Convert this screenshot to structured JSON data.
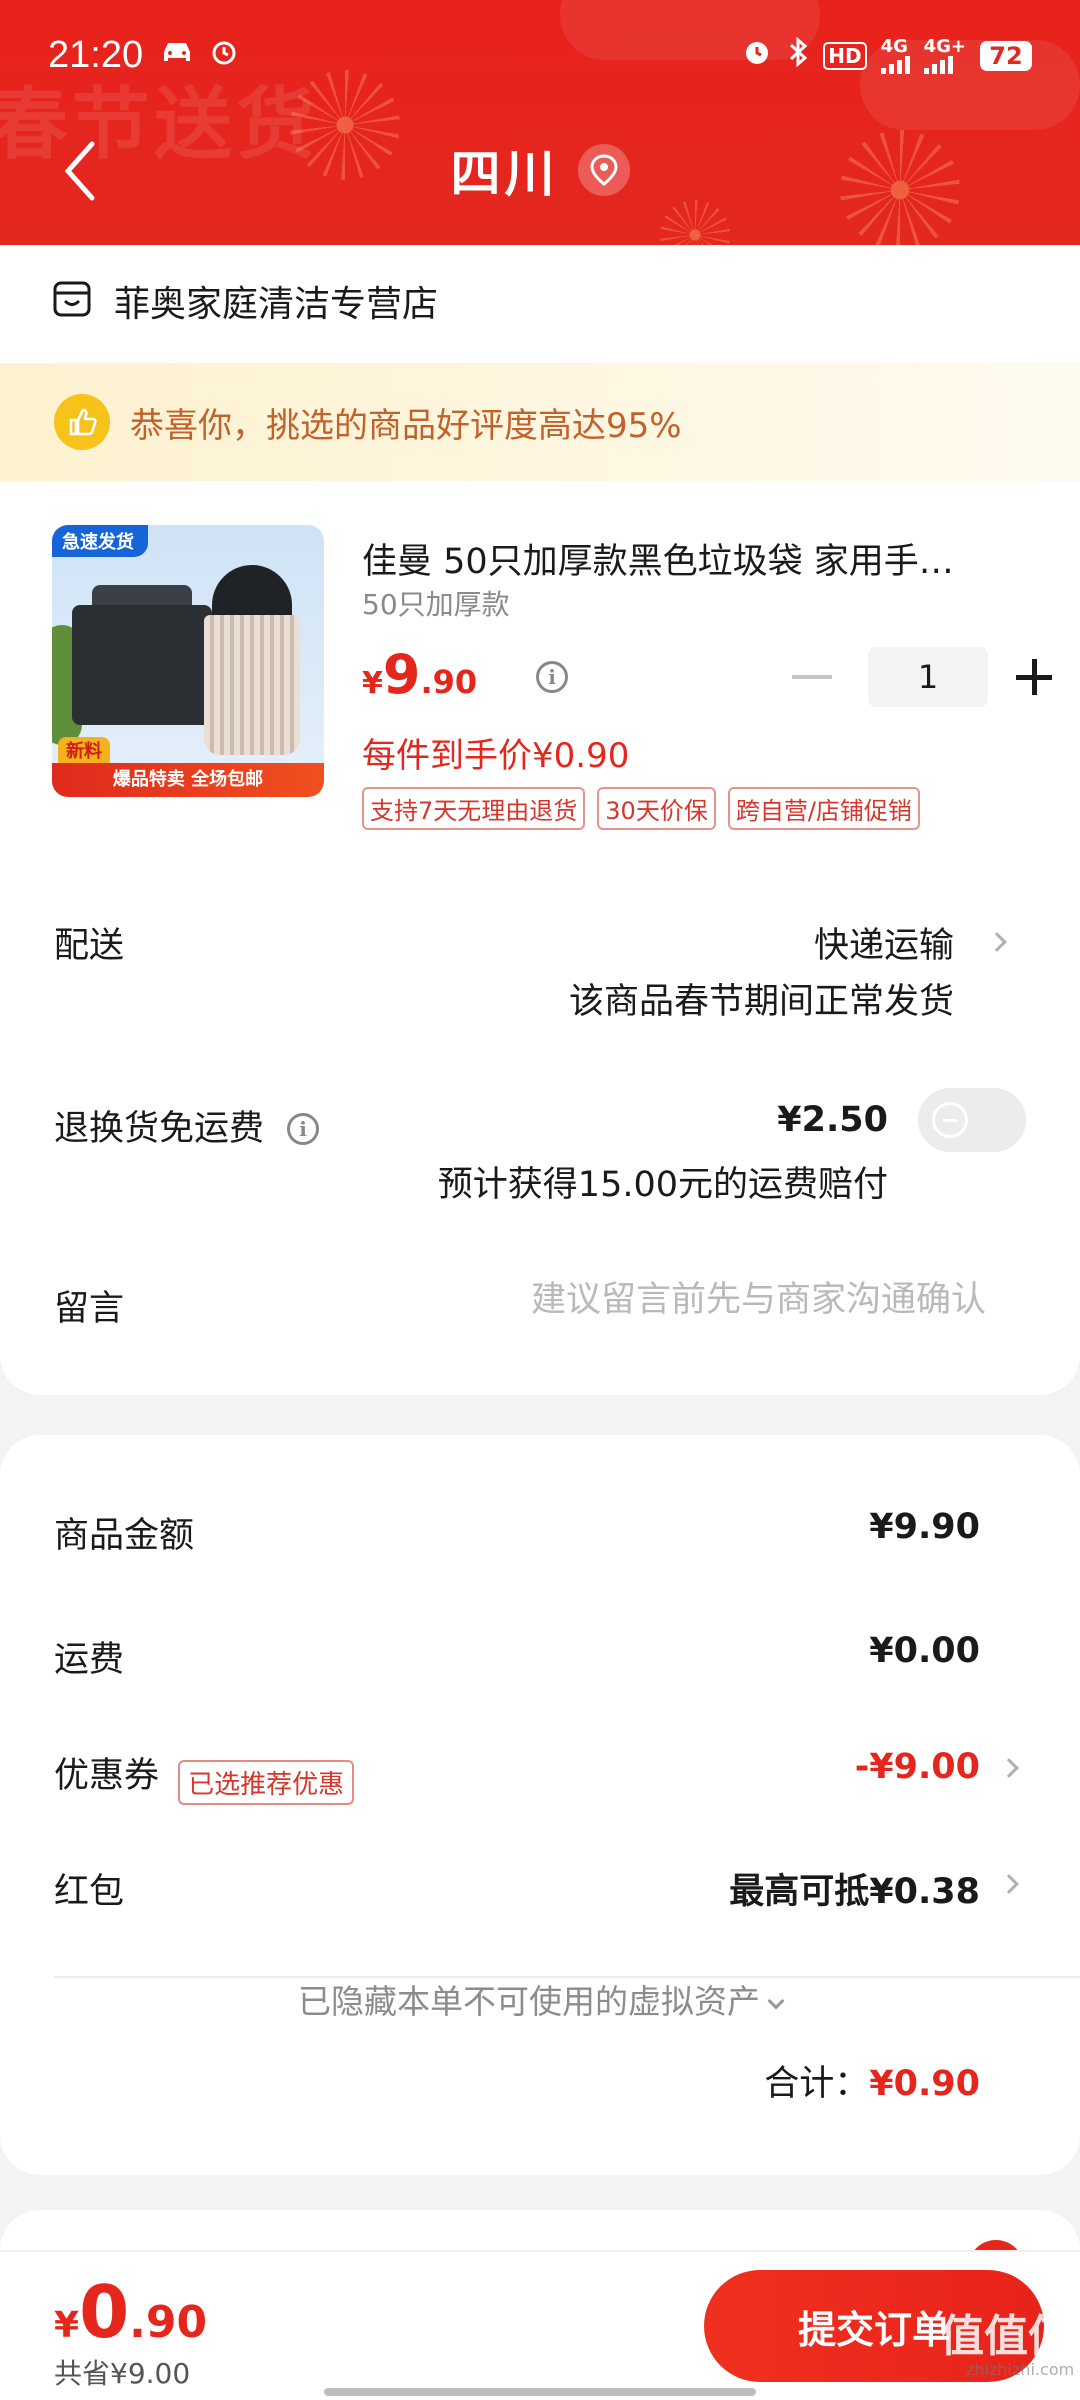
{
  "status_bar": {
    "time": "21:20",
    "battery": "72",
    "network_1": "4G",
    "network_2": "4G+",
    "hd_label": "HD"
  },
  "header": {
    "decor_text": "春节送货",
    "title": "四川"
  },
  "store": {
    "name": "菲奥家庭清洁专营店"
  },
  "banner": {
    "text": "恭喜你，挑选的商品好评度高达95%"
  },
  "product": {
    "title": "佳曼 50只加厚款黑色垃圾袋 家用手…",
    "spec": "50只加厚款",
    "price_currency": "¥",
    "price_int": "9",
    "price_dec": ".90",
    "quantity": "1",
    "unit_price": "每件到手价¥0.90",
    "image_tag_top": "急速发货",
    "image_tag_new": "新料",
    "image_tag_bottom": "爆品特卖 全场包邮",
    "chips": [
      "支持7天无理由退货",
      "30天价保",
      "跨自营/店铺促销"
    ]
  },
  "delivery": {
    "label": "配送",
    "method": "快递运输",
    "note": "该商品春节期间正常发货"
  },
  "return_shipping": {
    "label": "退换货免运费",
    "price": "¥2.50",
    "note": "预计获得15.00元的运费赔付",
    "enabled": false
  },
  "message": {
    "label": "留言",
    "value": "",
    "placeholder": "建议留言前先与商家沟通确认"
  },
  "summary": {
    "goods_label": "商品金额",
    "goods_value": "¥9.90",
    "shipping_label": "运费",
    "shipping_value": "¥0.00",
    "coupon_label": "优惠券",
    "coupon_chip": "已选推荐优惠",
    "coupon_value": "-¥9.00",
    "redpacket_label": "红包",
    "redpacket_value": "最高可抵¥0.38",
    "hidden_assets": "已隐藏本单不可使用的虚拟资产",
    "total_label": "合计：",
    "total_value": "¥0.90"
  },
  "bottom_bar": {
    "pay_currency": "¥",
    "pay_int": "0",
    "pay_dec": ".90",
    "saved": "共省¥9.00",
    "submit_label": "提交订单"
  },
  "watermark": {
    "text": "值值值",
    "sub": "zhizhizhi.com"
  },
  "colors": {
    "accent": "#e5261c",
    "header_bg": "#e3281f",
    "banner_bg": "#fdf1cf",
    "banner_text": "#c2612a"
  }
}
